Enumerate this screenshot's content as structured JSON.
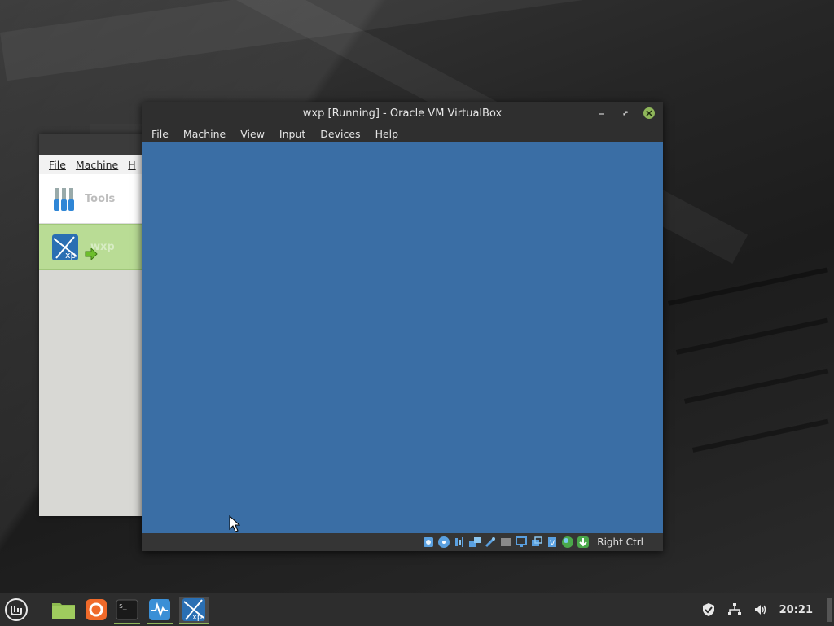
{
  "manager": {
    "menu": [
      "File",
      "Machine",
      "H"
    ],
    "tools_label": "Tools",
    "vm_label": "wxp"
  },
  "vm_window": {
    "title": "wxp [Running] - Oracle VM VirtualBox",
    "menu": {
      "file": "File",
      "machine": "Machine",
      "view": "View",
      "input": "Input",
      "devices": "Devices",
      "help": "Help"
    },
    "screen_color": "#3a6ea5",
    "status_icons": [
      "hard-disk-icon",
      "optical-drive-icon",
      "audio-icon",
      "network-icon",
      "usb-icon",
      "shared-folders-icon",
      "display-icon",
      "recording-icon",
      "cpu-icon",
      "mouse-integration-icon",
      "keyboard-capture-icon"
    ],
    "host_key": "Right Ctrl"
  },
  "taskbar": {
    "clock": "20:21",
    "accent": "#8fb65a"
  }
}
